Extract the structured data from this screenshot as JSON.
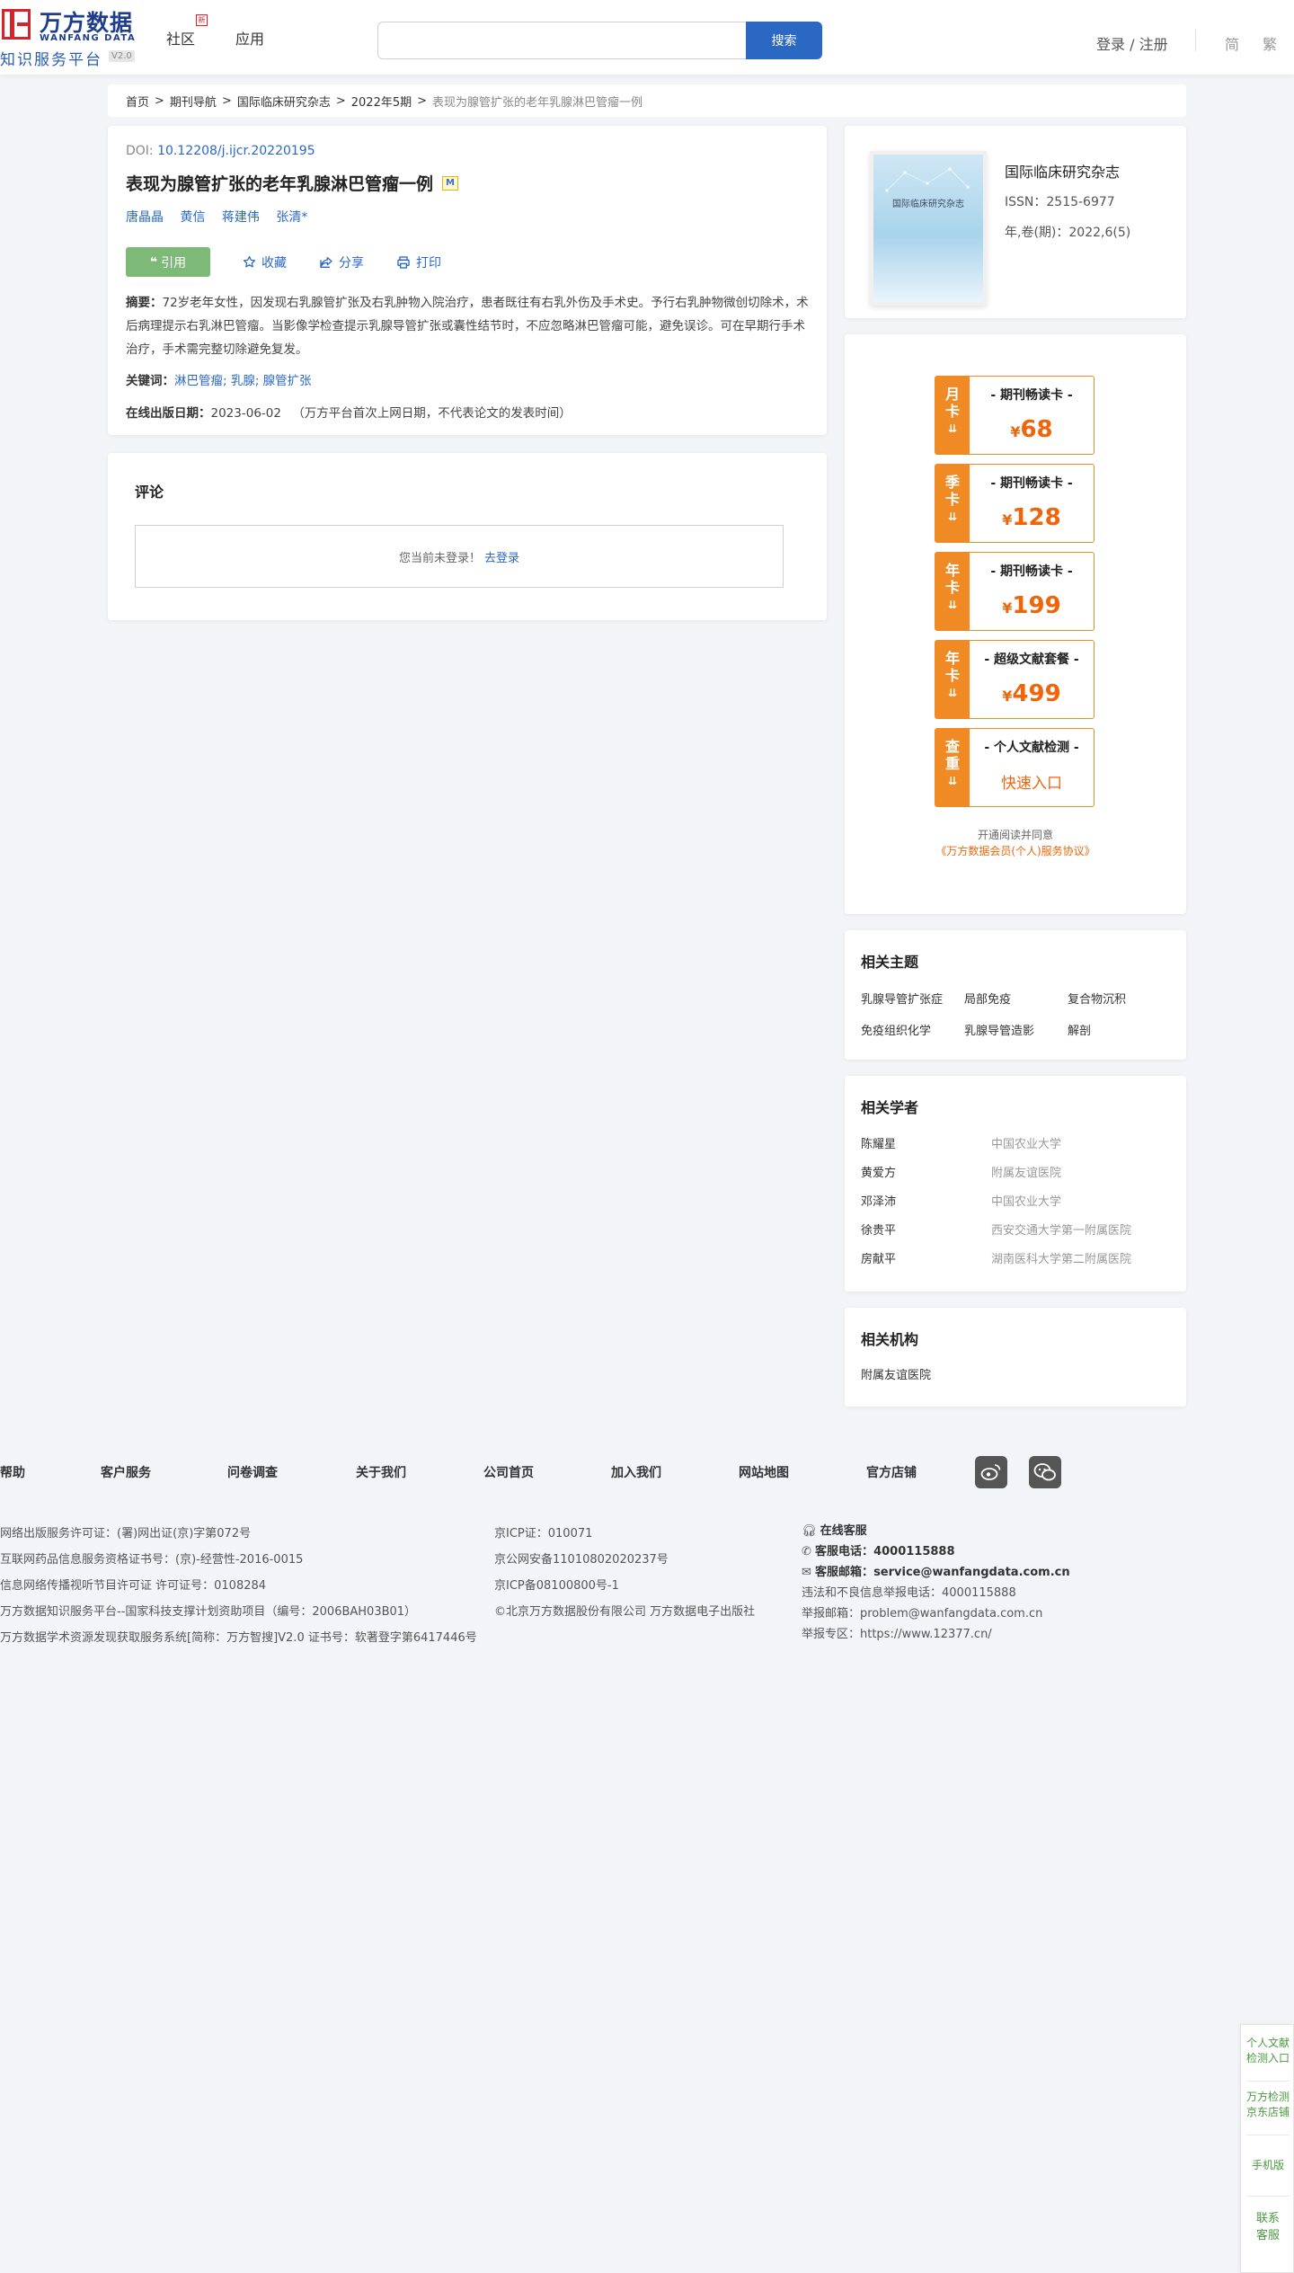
{
  "header": {
    "logo_cn": "万方数据",
    "logo_en": "WANFANG DATA",
    "logo_sub": "知识服务平台",
    "logo_version": "V2.0",
    "nav": [
      {
        "label": "社区"
      },
      {
        "label": "应用"
      }
    ],
    "nav_badge": "新",
    "search_placeholder": "",
    "search_button": "搜索",
    "login": "登录 / 注册",
    "lang_simplified": "简",
    "lang_traditional": "繁"
  },
  "breadcrumb": {
    "items": [
      "首页",
      "期刊导航",
      "国际临床研究杂志",
      "2022年5期"
    ],
    "current": "表现为腺管扩张的老年乳腺淋巴管瘤一例",
    "sep": ">"
  },
  "article": {
    "doi_label": "DOI: ",
    "doi": "10.12208/j.ijcr.20220195",
    "title": "表现为腺管扩张的老年乳腺淋巴管瘤一例",
    "title_badge": "M",
    "authors": [
      "唐晶晶",
      "黄信",
      "蒋建伟",
      "张清*"
    ],
    "actions": {
      "cite": "引用",
      "favorite": "收藏",
      "share": "分享",
      "print": "打印"
    },
    "abstract_label": "摘要：",
    "abstract": "72岁老年女性，因发现右乳腺管扩张及右乳肿物入院治疗，患者既往有右乳外伤及手术史。予行右乳肿物微创切除术，术后病理提示右乳淋巴管瘤。当影像学检查提示乳腺导管扩张或囊性结节时，不应忽略淋巴管瘤可能，避免误诊。可在早期行手术治疗，手术需完整切除避免复发。",
    "keywords_label": "关键词：",
    "keywords": "淋巴管瘤; 乳腺; 腺管扩张",
    "pubdate_label": "在线出版日期：",
    "pubdate": "2023-06-02",
    "pubdate_note": "（万方平台首次上网日期，不代表论文的发表时间）"
  },
  "comment": {
    "title": "评论",
    "prompt": "您当前未登录！",
    "login_link": "去登录"
  },
  "journal": {
    "cover_title": "国际临床研究杂志",
    "name": "国际临床研究杂志",
    "issn": "ISSN：2515-6977",
    "volume": "年,卷(期)：2022,6(5)"
  },
  "membership": {
    "currency": "¥",
    "cards": [
      {
        "side": [
          "月",
          "卡"
        ],
        "name": "- 期刊畅读卡 -",
        "price": "68"
      },
      {
        "side": [
          "季",
          "卡"
        ],
        "name": "- 期刊畅读卡 -",
        "price": "128"
      },
      {
        "side": [
          "年",
          "卡"
        ],
        "name": "- 期刊畅读卡 -",
        "price": "199"
      },
      {
        "side": [
          "年",
          "卡"
        ],
        "name": "- 超级文献套餐 -",
        "price": "499"
      },
      {
        "side": [
          "查",
          "重"
        ],
        "name": "- 个人文献检测 -",
        "entry": "快速入口"
      }
    ],
    "agree_text": "开通阅读并同意",
    "agree_link": "《万方数据会员(个人)服务协议》"
  },
  "related_topics": {
    "title": "相关主题",
    "items": [
      "乳腺导管扩张症",
      "局部免疫",
      "复合物沉积",
      "免疫组织化学",
      "乳腺导管造影",
      "解剖"
    ]
  },
  "related_scholars": {
    "title": "相关学者",
    "items": [
      {
        "name": "陈耀星",
        "org": "中国农业大学"
      },
      {
        "name": "黄爱方",
        "org": "附属友谊医院"
      },
      {
        "name": "邓泽沛",
        "org": "中国农业大学"
      },
      {
        "name": "徐贵平",
        "org": "西安交通大学第一附属医院"
      },
      {
        "name": "房献平",
        "org": "湖南医科大学第二附属医院"
      }
    ]
  },
  "related_institutions": {
    "title": "相关机构",
    "items": [
      "附属友谊医院"
    ]
  },
  "footer": {
    "links": [
      "帮助",
      "客户服务",
      "问卷调查",
      "关于我们",
      "公司首页",
      "加入我们",
      "网站地图",
      "官方店铺"
    ],
    "col1": [
      "网络出版服务许可证：(署)网出证(京)字第072号",
      "互联网药品信息服务资格证书号：(京)-经营性-2016-0015",
      "信息网络传播视听节目许可证 许可证号：0108284",
      "万方数据知识服务平台--国家科技支撑计划资助项目（编号：2006BAH03B01）",
      "万方数据学术资源发现获取服务系统[简称：万方智搜]V2.0 证书号：软著登字第6417446号"
    ],
    "col2": [
      "京ICP证：010071",
      "京公网安备11010802020237号",
      "京ICP备08100800号-1",
      "©北京万方数据股份有限公司 万方数据电子出版社"
    ],
    "online": "在线客服",
    "phone_label": "客服电话：",
    "phone": "4000115888",
    "email_label": "客服邮箱：",
    "email": "service@wanfangdata.com.cn",
    "report_phone": "违法和不良信息举报电话：4000115888",
    "report_email": "举报邮箱：problem@wanfangdata.com.cn",
    "report_site": "举报专区：https://www.12377.cn/"
  },
  "float_bar": {
    "items": [
      "个人文献检测入口",
      "万方检测京东店铺",
      "手机版",
      "联系客服"
    ]
  },
  "colors": {
    "brand_blue": "#2b68c4",
    "orange": "#f08a24",
    "cite_green": "#7dba77"
  }
}
